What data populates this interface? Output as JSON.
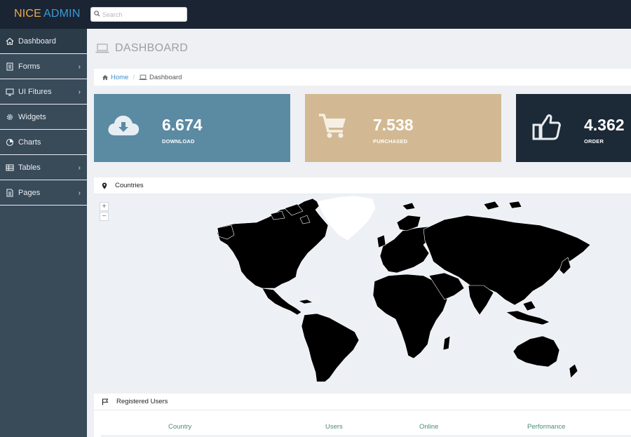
{
  "brand": {
    "part1": "NICE",
    "part2": "ADMIN"
  },
  "search": {
    "placeholder": "Search",
    "value": ""
  },
  "sidebar": {
    "items": [
      {
        "label": "Dashboard",
        "icon": "home-icon",
        "has_submenu": false,
        "active": true
      },
      {
        "label": "Forms",
        "icon": "document-icon",
        "has_submenu": true
      },
      {
        "label": "UI Fitures",
        "icon": "monitor-icon",
        "has_submenu": true
      },
      {
        "label": "Widgets",
        "icon": "cog-icon",
        "has_submenu": false
      },
      {
        "label": "Charts",
        "icon": "pie-chart-icon",
        "has_submenu": false
      },
      {
        "label": "Tables",
        "icon": "table-icon",
        "has_submenu": true
      },
      {
        "label": "Pages",
        "icon": "file-icon",
        "has_submenu": true
      }
    ]
  },
  "page": {
    "title": "DASHBOARD"
  },
  "breadcrumb": {
    "home": "Home",
    "current": "Dashboard"
  },
  "stats": [
    {
      "value": "6.674",
      "label": "DOWNLOAD",
      "icon": "cloud-download-icon",
      "color": "#5b8aa3"
    },
    {
      "value": "7.538",
      "label": "PURCHASED",
      "icon": "shopping-cart-icon",
      "color": "#d2b993"
    },
    {
      "value": "4.362",
      "label": "ORDER",
      "icon": "thumbs-up-icon",
      "color": "#1c2937"
    }
  ],
  "countries_panel": {
    "title": "Countries",
    "zoom_in": "+",
    "zoom_out": "−"
  },
  "users_panel": {
    "title": "Registered Users",
    "columns": [
      "Country",
      "Users",
      "Online",
      "Performance"
    ]
  },
  "colors": {
    "topbar": "#1a2433",
    "sidebar": "#394a59",
    "accent": "#3b9bd6",
    "brand_orange": "#e8a94e"
  }
}
